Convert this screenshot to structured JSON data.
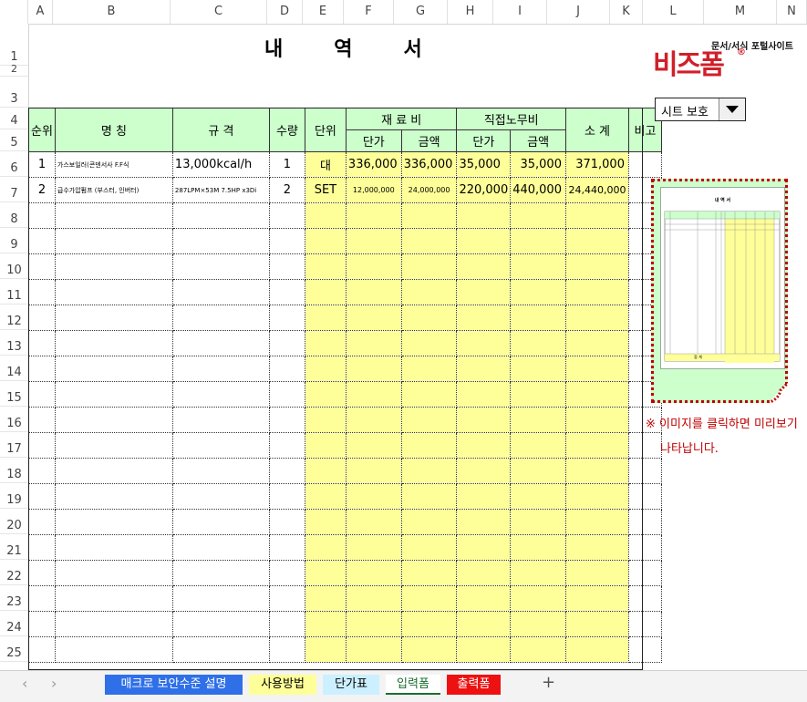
{
  "columns": [
    "A",
    "B",
    "C",
    "D",
    "E",
    "F",
    "G",
    "H",
    "I",
    "J",
    "K",
    "L",
    "M",
    "N"
  ],
  "rows": [
    "1",
    "2",
    "3",
    "4",
    "5",
    "6",
    "7",
    "8",
    "9",
    "10",
    "11",
    "12",
    "13",
    "14",
    "15",
    "16",
    "17",
    "18",
    "19",
    "20",
    "21",
    "22",
    "23",
    "24",
    "25"
  ],
  "title_chars": [
    "내",
    "역",
    "서"
  ],
  "header": {
    "seq": "순위",
    "name": "명      칭",
    "spec": "규      격",
    "qty": "수량",
    "unit": "단위",
    "material": "재 료 비",
    "labor": "직접노무비",
    "subtotal": "소  계",
    "remark": "비고",
    "unit_price": "단가",
    "amount": "금액"
  },
  "items": [
    {
      "seq": "1",
      "name": "가스보일러(콘덴서사 F.F식",
      "spec": "13,000kcal/h",
      "qty": "1",
      "unit": "대",
      "mat_price": "336,000",
      "mat_amount": "336,000",
      "lab_price": "35,000",
      "lab_amount": "35,000",
      "subtotal": "371,000"
    },
    {
      "seq": "2",
      "name": "급수가압펌프 (부스터, 인버터)",
      "spec": "287LPM×53M 7.5HP x3Di",
      "qty": "2",
      "unit": "SET",
      "mat_price": "12,000,000",
      "mat_amount": "24,000,000",
      "lab_price": "220,000",
      "lab_amount": "440,000",
      "subtotal": "24,440,000"
    }
  ],
  "logo": {
    "main": "비즈폼",
    "sub": "문서/서식 포털사이트",
    "mark": "®",
    "color": "#d0202a"
  },
  "protect_dropdown": {
    "value": "시트 보호"
  },
  "preview": {
    "title": "내 역 서",
    "footer": "합  계"
  },
  "notes": [
    "※ 이미지를 클릭하면 미리보기",
    "나타납니다."
  ],
  "tabs": [
    {
      "label": "매크로 보안수준 설명",
      "color": "#2f6fe8",
      "text_color": "#ffffff"
    },
    {
      "label": "사용방법",
      "color": "#ffff99",
      "text_color": "#000000"
    },
    {
      "label": "단가표",
      "color": "#ccf0ff",
      "text_color": "#000000"
    },
    {
      "label": "입력폼",
      "color": "#ffffff",
      "text_color": "#1b6e2f",
      "active": true
    },
    {
      "label": "출력폼",
      "color": "#ee1111",
      "text_color": "#ffffff"
    }
  ],
  "add_sheet": "+",
  "nav_prev": "‹",
  "nav_next": "›",
  "colors": {
    "header_green": "#ccffcc",
    "input_yellow": "#ffff99",
    "note_red": "#c00000"
  }
}
